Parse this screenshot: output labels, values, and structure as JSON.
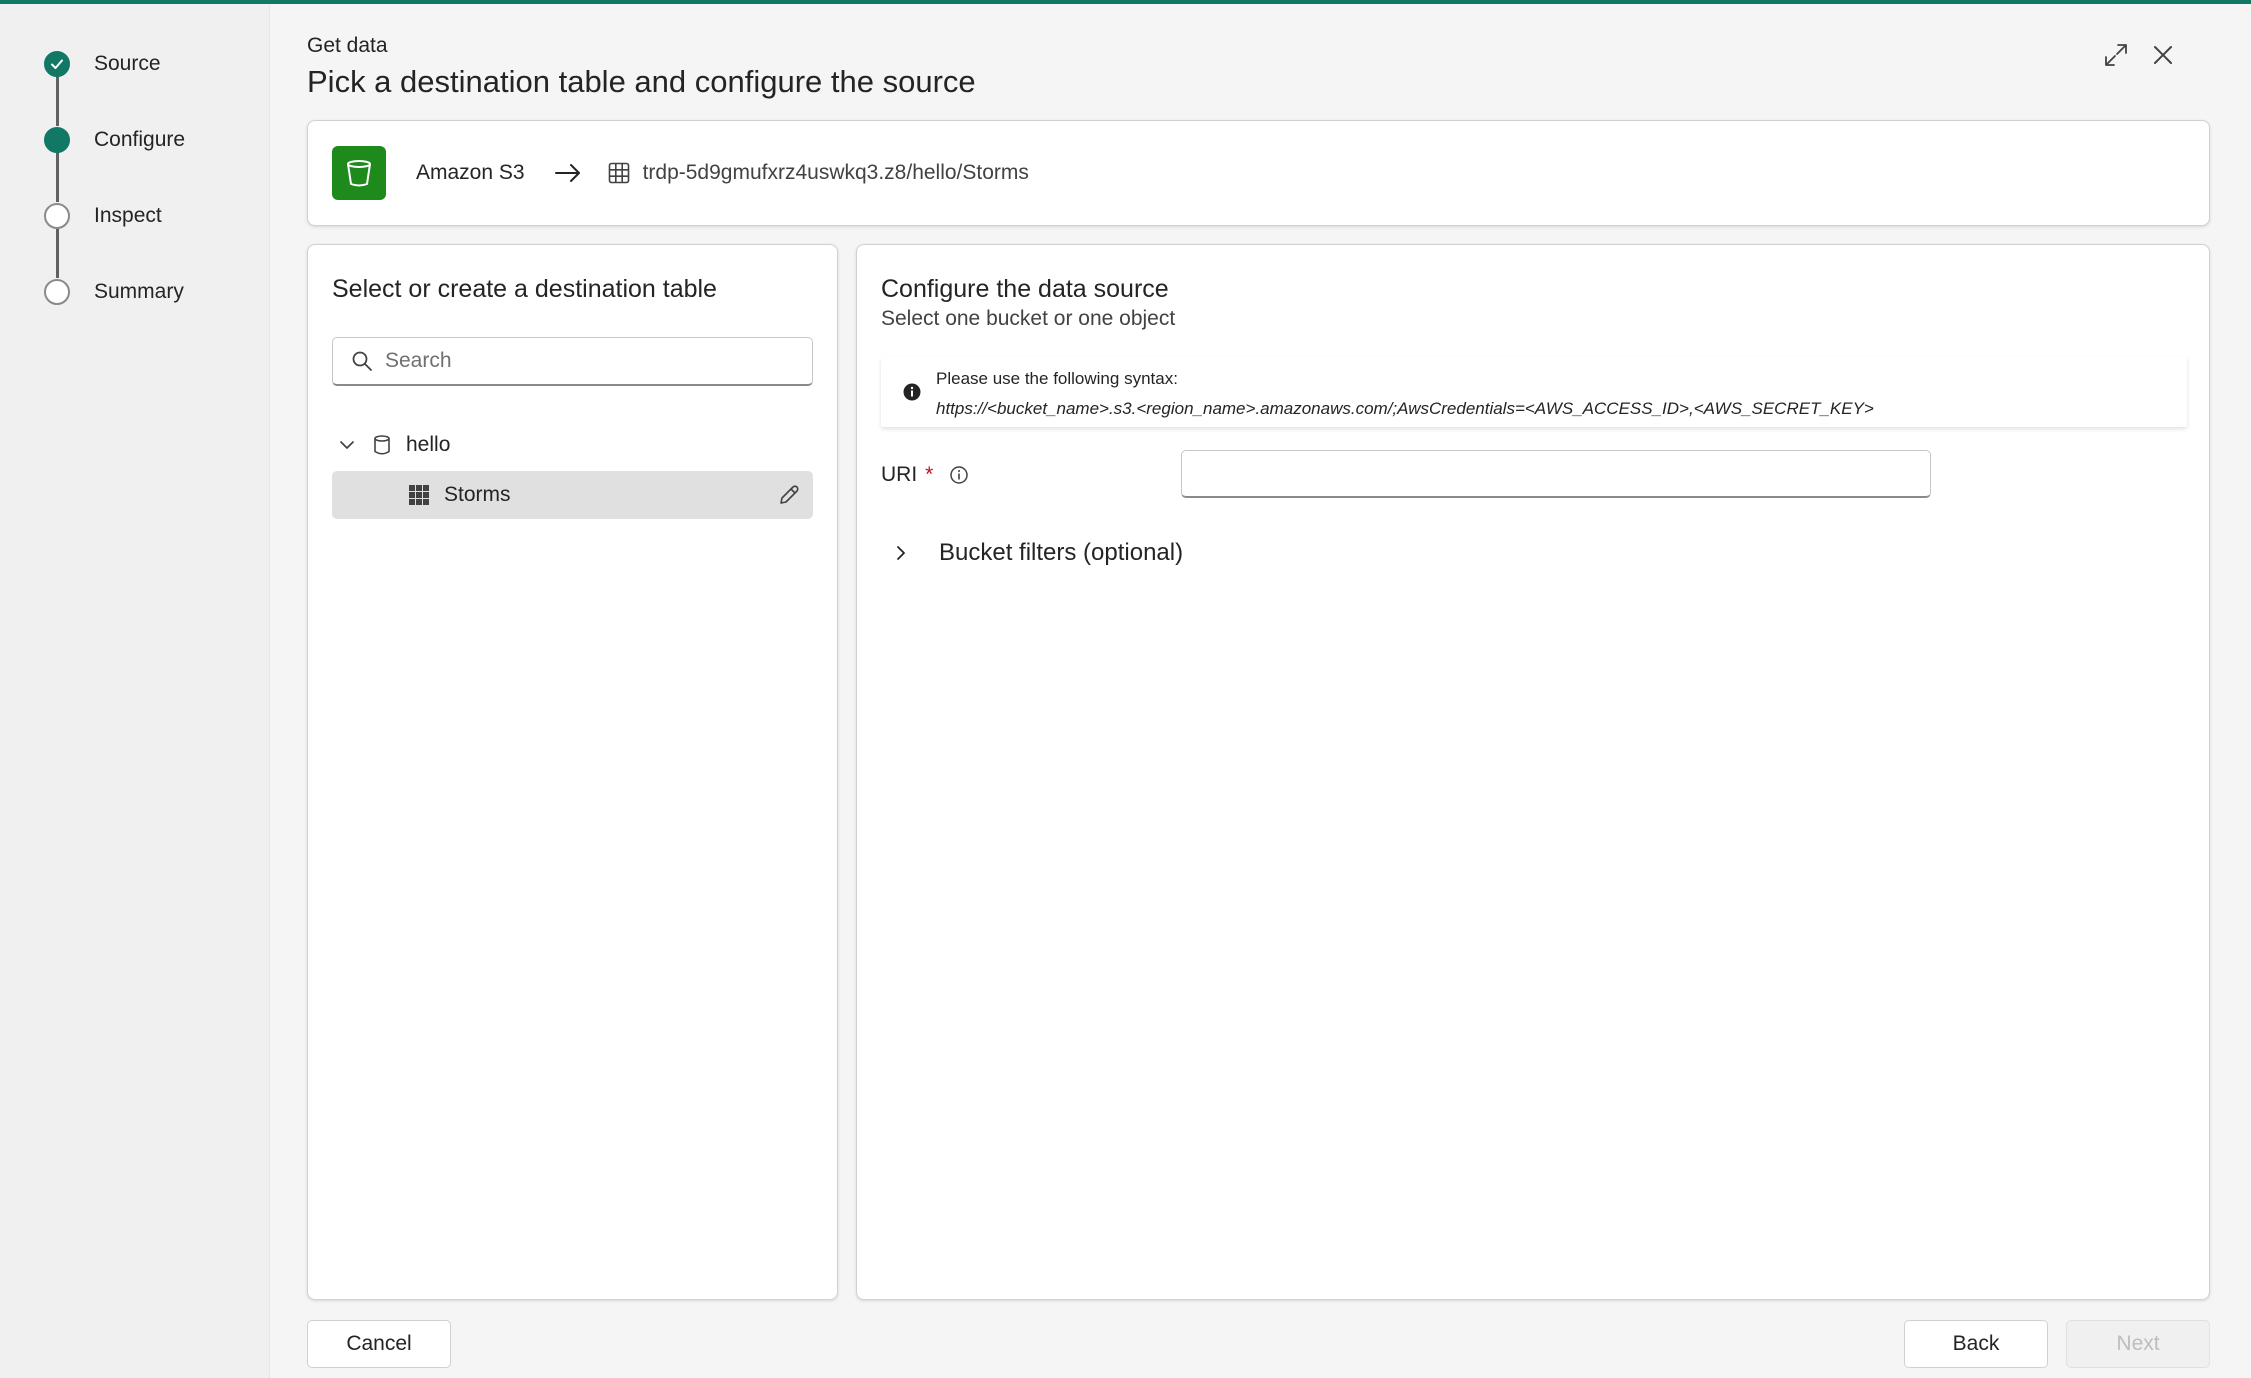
{
  "header": {
    "small_title": "Get data",
    "title": "Pick a destination table and configure the source"
  },
  "steps": [
    {
      "label": "Source",
      "state": "done"
    },
    {
      "label": "Configure",
      "state": "active"
    },
    {
      "label": "Inspect",
      "state": "pending"
    },
    {
      "label": "Summary",
      "state": "pending"
    }
  ],
  "flow": {
    "source_name": "Amazon S3",
    "destination": "trdp-5d9gmufxrz4uswkq3.z8/hello/Storms"
  },
  "destination_panel": {
    "title": "Select or create a destination table",
    "search_placeholder": "Search",
    "database": "hello",
    "table": "Storms"
  },
  "source_panel": {
    "title": "Configure the data source",
    "subtitle": "Select one bucket or one object",
    "info_line1": "Please use the following syntax:",
    "info_line2": "https://<bucket_name>.s3.<region_name>.amazonaws.com/;AwsCredentials=<AWS_ACCESS_ID>,<AWS_SECRET_KEY>",
    "uri_label": "URI",
    "uri_required": "*",
    "uri_value": "",
    "bucket_filters": "Bucket filters (optional)"
  },
  "footer": {
    "cancel": "Cancel",
    "back": "Back",
    "next": "Next"
  },
  "colors": {
    "accent": "#117865",
    "s3_brand": "#1d8a1b",
    "required": "#c50f1f"
  }
}
